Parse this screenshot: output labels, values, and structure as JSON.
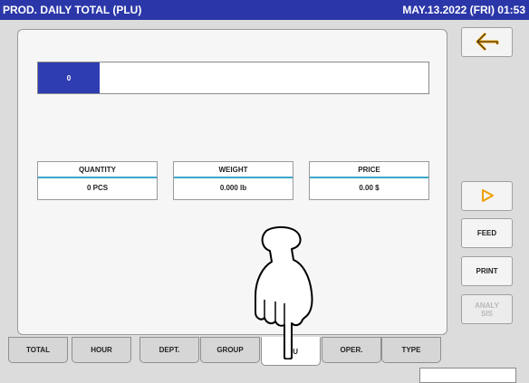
{
  "titlebar": {
    "title": "PROD. DAILY TOTAL (PLU)",
    "datetime": "MAY.13.2022 (FRI) 01:53"
  },
  "plu": {
    "code": "0",
    "name": ""
  },
  "stats": {
    "quantity": {
      "label": "QUANTITY",
      "value": "0 PCS"
    },
    "weight": {
      "label": "WEIGHT",
      "value": "0.000 lb"
    },
    "price": {
      "label": "PRICE",
      "value": "0.00 $"
    }
  },
  "side": {
    "back_icon": "return-arrow-icon",
    "next_icon": "play-triangle-icon",
    "feed_label": "FEED",
    "print_label": "PRINT",
    "analysis_label_1": "ANALY",
    "analysis_label_2": "SIS"
  },
  "tabs": [
    "TOTAL",
    "HOUR",
    "DEPT.",
    "GROUP",
    "PLU",
    "OPER.",
    "TYPE"
  ],
  "active_tab": "PLU",
  "colors": {
    "title_bar": "#2b37a8",
    "accent": "#3aa7c9",
    "arrow": "#f0a000"
  }
}
